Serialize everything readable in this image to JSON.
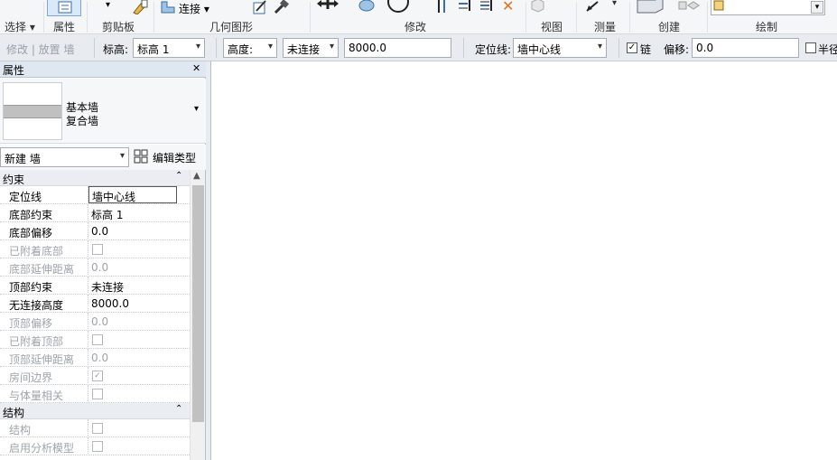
{
  "ribbon": {
    "groups": {
      "select": "选择",
      "properties": "属性",
      "clipboard": "剪贴板",
      "geometry": "几何图形",
      "modify": "修改",
      "view": "视图",
      "measure": "测量",
      "create": "创建",
      "draw": "绘制"
    },
    "join_label": "连接",
    "icons": [
      "properties-icon",
      "paste-icon",
      "join-icon",
      "cut-geometry-icon",
      "demolish-icon",
      "move-icon",
      "paint-icon",
      "circle-icon",
      "align-icon",
      "offset-icon",
      "mirror-icon",
      "delete-icon",
      "view-cube-icon",
      "measure-icon",
      "create-part-icon",
      "draw-line-icon"
    ]
  },
  "options_bar": {
    "modify_place": "修改 | 放置 墙",
    "level_label": "标高:",
    "level_value": "标高 1",
    "height_label": "高度:",
    "height_mode": "未连接",
    "height_value": "8000.0",
    "location_label": "定位线:",
    "location_value": "墙中心线",
    "chain_label": "链",
    "chain_checked": true,
    "offset_label": "偏移:",
    "offset_value": "0.0",
    "radius_label": "半径"
  },
  "properties": {
    "title": "属性",
    "close_glyph": "✕",
    "type_family": "基本墙",
    "type_name": "复合墙",
    "instance_selector": "新建 墙",
    "edit_type": "编辑类型",
    "sections": [
      {
        "name": "约束",
        "rows": [
          {
            "key": "定位线",
            "value": "墙中心线",
            "disabled": false,
            "kind": "text"
          },
          {
            "key": "底部约束",
            "value": "标高 1",
            "disabled": false,
            "kind": "text"
          },
          {
            "key": "底部偏移",
            "value": "0.0",
            "disabled": false,
            "kind": "text"
          },
          {
            "key": "已附着底部",
            "value": "",
            "disabled": true,
            "kind": "checkbox"
          },
          {
            "key": "底部延伸距离",
            "value": "0.0",
            "disabled": true,
            "kind": "text"
          },
          {
            "key": "顶部约束",
            "value": "未连接",
            "disabled": false,
            "kind": "text"
          },
          {
            "key": "无连接高度",
            "value": "8000.0",
            "disabled": false,
            "kind": "text"
          },
          {
            "key": "顶部偏移",
            "value": "0.0",
            "disabled": true,
            "kind": "text"
          },
          {
            "key": "已附着顶部",
            "value": "",
            "disabled": true,
            "kind": "checkbox"
          },
          {
            "key": "顶部延伸距离",
            "value": "0.0",
            "disabled": true,
            "kind": "text"
          },
          {
            "key": "房间边界",
            "value": "✓",
            "disabled": true,
            "kind": "checkbox"
          },
          {
            "key": "与体量相关",
            "value": "",
            "disabled": true,
            "kind": "checkbox"
          }
        ]
      },
      {
        "name": "结构",
        "rows": [
          {
            "key": "结构",
            "value": "",
            "disabled": true,
            "kind": "checkbox"
          },
          {
            "key": "启用分析模型",
            "value": "",
            "disabled": true,
            "kind": "checkbox"
          }
        ]
      }
    ]
  }
}
